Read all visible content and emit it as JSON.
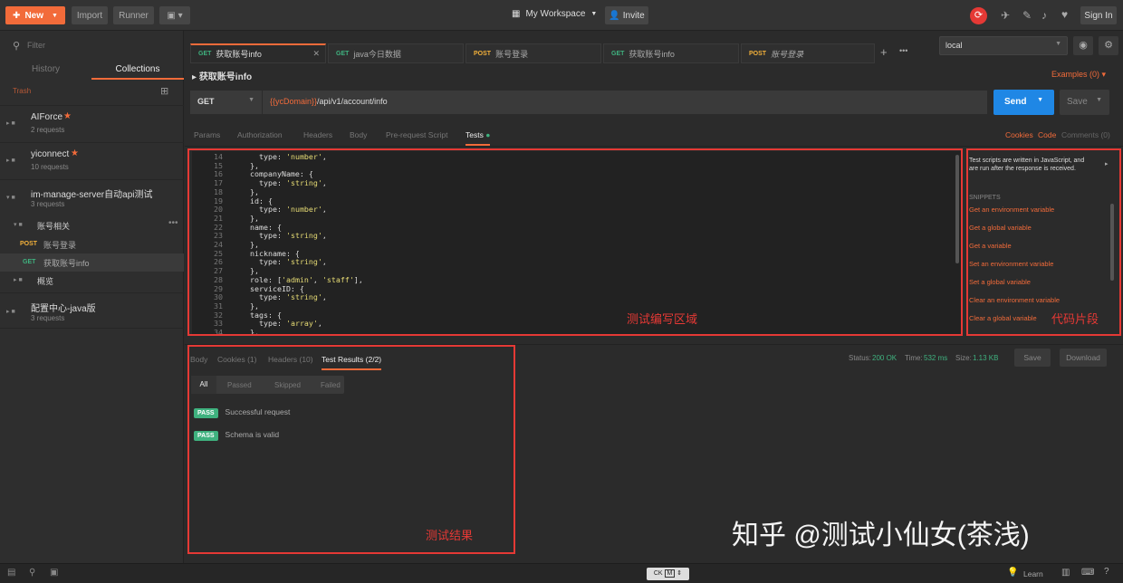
{
  "topbar": {
    "new": "New",
    "import": "Import",
    "runner": "Runner",
    "workspace": "My Workspace",
    "invite": "Invite",
    "signin": "Sign In"
  },
  "sidebar": {
    "filter_placeholder": "Filter",
    "history": "History",
    "collections": "Collections",
    "trash": "Trash",
    "collections_list": [
      {
        "name": "AIForce",
        "count": "2 requests",
        "star": true
      },
      {
        "name": "yiconnect",
        "count": "10 requests",
        "star": true
      },
      {
        "name": "im-manage-server自动api测试",
        "count": "3 requests"
      },
      {
        "name": "配置中心-java版",
        "count": "3 requests"
      }
    ],
    "folder": "账号相关",
    "folder2": "概览",
    "req1": {
      "method": "POST",
      "name": "账号登录"
    },
    "req2": {
      "method": "GET",
      "name": "获取账号info"
    }
  },
  "tabs": [
    {
      "method": "GET",
      "name": "获取账号info"
    },
    {
      "method": "GET",
      "name": "java今日数据"
    },
    {
      "method": "POST",
      "name": "账号登录"
    },
    {
      "method": "GET",
      "name": "获取账号info"
    },
    {
      "method": "POST",
      "name": "账号登录"
    }
  ],
  "env": "local",
  "request": {
    "title": "获取账号info",
    "examples": "Examples (0)",
    "method": "GET",
    "url_var": "{{ycDomain}}",
    "url_rest": "/api/v1/account/info",
    "send": "Send",
    "save": "Save"
  },
  "subtabs": [
    "Params",
    "Authorization",
    "Headers",
    "Body",
    "Pre-request Script",
    "Tests"
  ],
  "subtab_links": [
    "Cookies",
    "Code",
    "Comments (0)"
  ],
  "editor": {
    "lines": [
      "14",
      "15",
      "16",
      "17",
      "18",
      "19",
      "20",
      "21",
      "22",
      "23",
      "24",
      "25",
      "26",
      "27",
      "28",
      "29",
      "30",
      "31",
      "32",
      "33",
      "34"
    ],
    "code": [
      "      type: 'number',",
      "    },",
      "    companyName: {",
      "      type: 'string',",
      "    },",
      "    id: {",
      "      type: 'number',",
      "    },",
      "    name: {",
      "      type: 'string',",
      "    },",
      "    nickname: {",
      "      type: 'string',",
      "    },",
      "    role: ['admin', 'staff'],",
      "    serviceID: {",
      "      type: 'string',",
      "    },",
      "    tags: {",
      "      type: 'array',",
      "    },"
    ]
  },
  "snippets": {
    "intro": "Test scripts are written in JavaScript, and are run after the response is received.",
    "heading": "SNIPPETS",
    "items": [
      "Get an environment variable",
      "Get a global variable",
      "Get a variable",
      "Set an environment variable",
      "Set a global variable",
      "Clear an environment variable",
      "Clear a global variable"
    ]
  },
  "response": {
    "tabs": [
      "Body",
      "Cookies (1)",
      "Headers (10)",
      "Test Results (2/2)"
    ],
    "status_label": "Status:",
    "status": "200 OK",
    "time_label": "Time:",
    "time": "532 ms",
    "size_label": "Size:",
    "size": "1.13 KB",
    "save": "Save",
    "download": "Download",
    "filters": [
      "All",
      "Passed",
      "Skipped",
      "Failed"
    ],
    "results": [
      {
        "badge": "PASS",
        "text": "Successful request"
      },
      {
        "badge": "PASS",
        "text": "Schema is valid"
      }
    ]
  },
  "annotations": {
    "editor": "测试编写区域",
    "snippets": "代码片段",
    "results": "测试结果"
  },
  "watermark": "知乎 @测试小仙女(茶浅)",
  "statusbar": {
    "learn": "Learn"
  },
  "colors": {
    "accent": "#f26b3a",
    "send": "#1f87e5",
    "pass": "#3fb27f",
    "annotation": "#e53935"
  }
}
